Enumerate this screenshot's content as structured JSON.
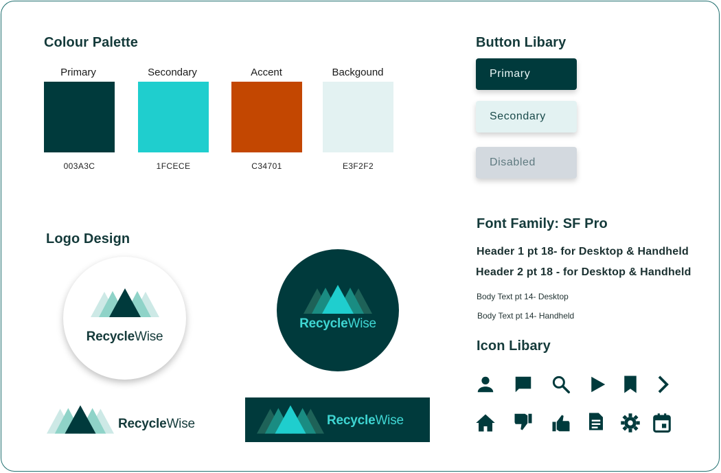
{
  "palette": {
    "title": "Colour Palette",
    "swatches": [
      {
        "label": "Primary",
        "hex": "003A3C",
        "color": "#003A3C"
      },
      {
        "label": "Secondary",
        "hex": "1FCECE",
        "color": "#1FCECE"
      },
      {
        "label": "Accent",
        "hex": "C34701",
        "color": "#C34701"
      },
      {
        "label": "Backgound",
        "hex": "E3F2F2",
        "color": "#E3F2F2"
      }
    ]
  },
  "buttons": {
    "title": "Button Libary",
    "primary": "Primary",
    "secondary": "Secondary",
    "disabled": "Disabled"
  },
  "logo": {
    "title": "Logo Design",
    "brand_bold": "Recycle",
    "brand_light": "Wise"
  },
  "fonts": {
    "title": "Font Family: SF Pro",
    "header1": "Header 1 pt 18- for Desktop & Handheld",
    "header2": "Header 2 pt 18 - for Desktop & Handheld",
    "body1": "Body Text pt 14- Desktop",
    "body2": "Body Text pt 14- Handheld"
  },
  "icons": {
    "title": "Icon Libary",
    "row1": [
      "person-icon",
      "chat-bubble-icon",
      "search-icon",
      "play-icon",
      "bookmark-icon",
      "chevron-right-icon"
    ],
    "row2": [
      "home-icon",
      "thumb-down-icon",
      "thumb-up-icon",
      "document-icon",
      "gear-icon",
      "calendar-icon"
    ]
  },
  "colors": {
    "primary": "#003A3C",
    "secondary": "#1FCECE",
    "accent": "#C34701",
    "background": "#E3F2F2"
  }
}
